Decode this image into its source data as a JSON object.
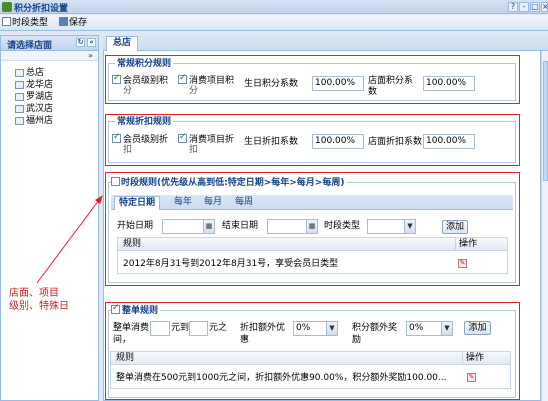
{
  "window": {
    "title": "积分折扣设置",
    "buttons": [
      "?",
      "-",
      "□",
      "×"
    ]
  },
  "toolbar": {
    "period_type": "时段类型",
    "save": "保存"
  },
  "left_panel": {
    "title": "请选择店面",
    "expand_label": "»",
    "stores": [
      "总店",
      "龙华店",
      "罗湖店",
      "武汉店",
      "福州店"
    ]
  },
  "main_tab": "总店",
  "points_rules": {
    "legend": "常规积分规则",
    "member_level": "会员级别积",
    "member_level_2": "分",
    "consume_item": "消费项目积",
    "consume_item_2": "分",
    "birthday_label": "生日积分系数",
    "birthday_value": "100.00%",
    "store_label": "店面积分系",
    "store_label_2": "数",
    "store_value": "100.00%"
  },
  "discount_rules": {
    "legend": "常规折扣规则",
    "member_level": "会员级别折",
    "member_level_2": "扣",
    "consume_item": "消费项目折",
    "consume_item_2": "扣",
    "birthday_label": "生日折扣系数",
    "birthday_value": "100.00%",
    "store_label": "店面折扣系数",
    "store_value": "100.00%"
  },
  "period_rules": {
    "legend": "时段规则(优先级从高到低:特定日期>每年>每月>每周)",
    "tabs": [
      "特定日期",
      "每年",
      "每月",
      "每周"
    ],
    "start_date_label": "开始日期",
    "end_date_label": "结束日期",
    "period_type_label": "时段类型",
    "add_button": "添加",
    "col_rule": "规则",
    "col_action": "操作",
    "rows": [
      "2012年8月31号到2012年8月31号，享受会员日类型"
    ]
  },
  "whole_order_rules": {
    "legend": "整单规则",
    "consume_label": "整单消费",
    "consume_label_2": "间，",
    "to_label": "元到",
    "yuan_between": "元之",
    "extra_discount_label": "折扣额外优",
    "extra_discount_label_2": "惠",
    "extra_discount_value": "0%",
    "extra_points_label": "积分额外奖",
    "extra_points_label_2": "励",
    "extra_points_value": "0%",
    "add_button": "添加",
    "col_rule": "规则",
    "col_action": "操作",
    "rows": [
      "整单消费在500元到1000元之间，折扣额外优惠90.00%，积分额外奖励100.00..."
    ]
  },
  "annotation": {
    "line1": "店面、项目",
    "line2": "级别、特殊日"
  },
  "colors": {
    "annotation": "#e0202a",
    "header_text": "#15428b",
    "panel_border": "#99bbe8"
  }
}
